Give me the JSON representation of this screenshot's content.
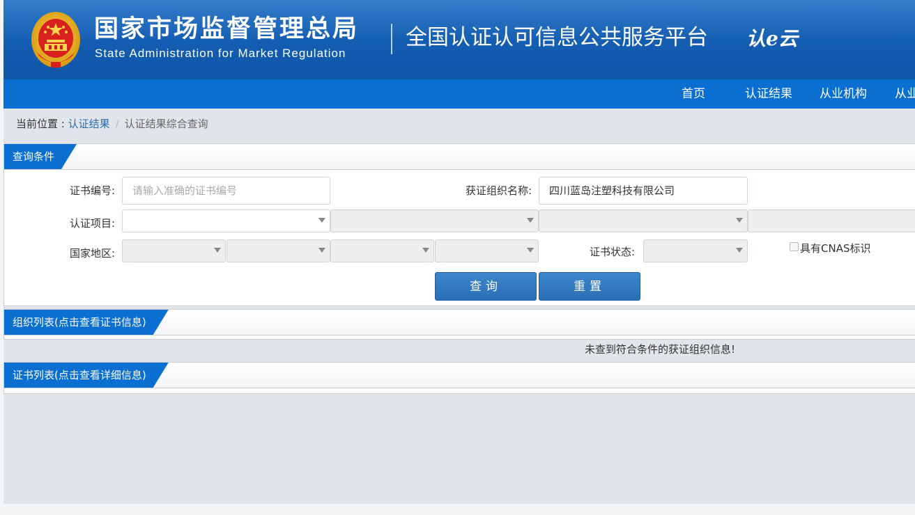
{
  "header": {
    "cn_title": "国家市场监督管理总局",
    "en_title": "State Administration  for  Market Regulation",
    "platform_title": "全国认证认可信息公共服务平台",
    "logo_text": "认e云"
  },
  "nav": {
    "items": [
      "首页",
      "认证结果",
      "从业机构",
      "从业"
    ]
  },
  "breadcrumb": {
    "label": "当前位置 : ",
    "link": "认证结果",
    "separator": "/",
    "current": "认证结果综合查询"
  },
  "query_panel": {
    "title": "查询条件",
    "cert_no_label": "证书编号:",
    "cert_no_placeholder": "请输入准确的证书编号",
    "org_name_label": "获证组织名称:",
    "org_name_value": "四川蓝岛注塑科技有限公司",
    "cert_item_label": "认证项目:",
    "region_label": "国家地区:",
    "cert_status_label": "证书状态:",
    "cnas_label": "具有CNAS标识",
    "search_button": "查询",
    "reset_button": "重置"
  },
  "org_panel": {
    "title": "组织列表(点击查看证书信息)",
    "empty_message": "未查到符合条件的获证组织信息!"
  },
  "cert_panel": {
    "title": "证书列表(点击查看详细信息)"
  },
  "colors": {
    "header_blue": "#155fb4",
    "nav_blue": "#0a6fd0",
    "button_blue": "#2a6fb5",
    "page_bg": "#e1e5e9"
  }
}
